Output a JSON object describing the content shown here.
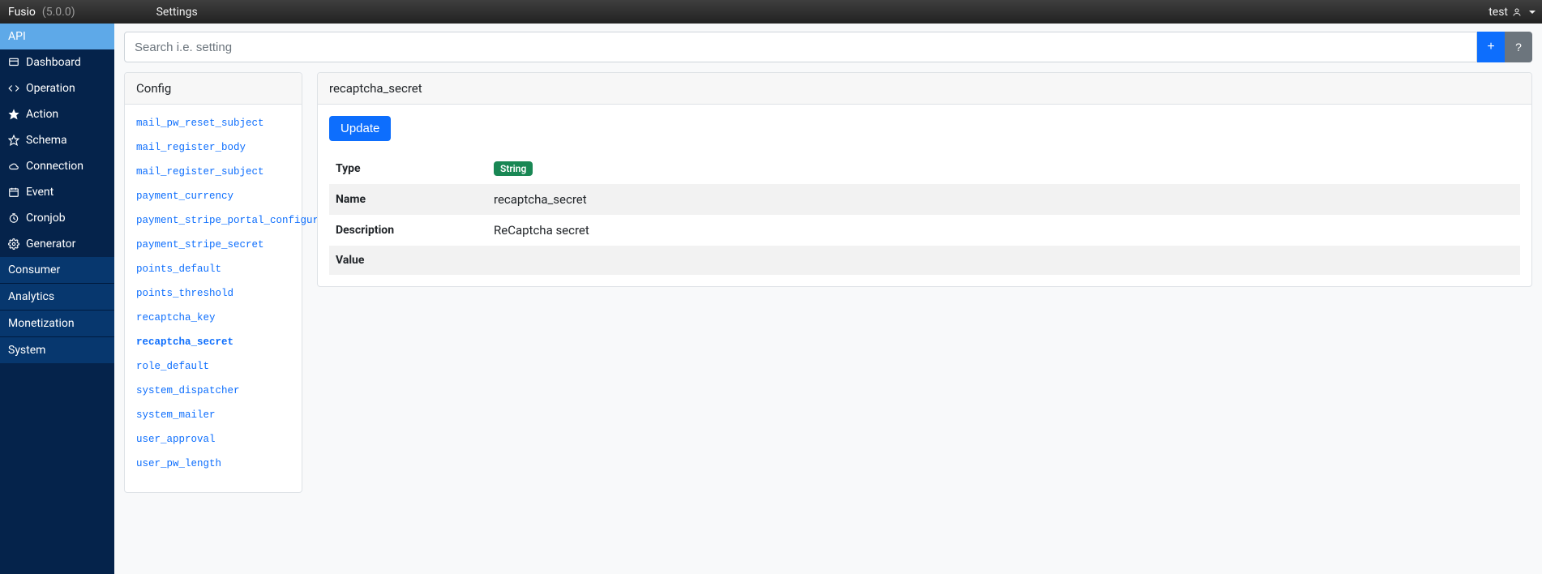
{
  "topbar": {
    "brand": "Fusio",
    "version": "(5.0.0)",
    "title": "Settings",
    "user": "test"
  },
  "sidebar": {
    "section_header": "API",
    "items": [
      {
        "id": "dashboard",
        "label": "Dashboard",
        "icon": "dashboard-icon"
      },
      {
        "id": "operation",
        "label": "Operation",
        "icon": "code-icon"
      },
      {
        "id": "action",
        "label": "Action",
        "icon": "star-icon"
      },
      {
        "id": "schema",
        "label": "Schema",
        "icon": "star-outline-icon"
      },
      {
        "id": "connection",
        "label": "Connection",
        "icon": "cloud-icon"
      },
      {
        "id": "event",
        "label": "Event",
        "icon": "calendar-icon"
      },
      {
        "id": "cronjob",
        "label": "Cronjob",
        "icon": "clock-icon"
      },
      {
        "id": "generator",
        "label": "Generator",
        "icon": "gear-icon"
      }
    ],
    "collapsed": [
      {
        "id": "consumer",
        "label": "Consumer"
      },
      {
        "id": "analytics",
        "label": "Analytics"
      },
      {
        "id": "monetization",
        "label": "Monetization"
      },
      {
        "id": "system",
        "label": "System"
      }
    ]
  },
  "search": {
    "placeholder": "Search i.e. setting",
    "add_label": "+",
    "help_label": "?"
  },
  "config_panel": {
    "header": "Config",
    "items": [
      "mail_pw_reset_subject",
      "mail_register_body",
      "mail_register_subject",
      "payment_currency",
      "payment_stripe_portal_configur",
      "payment_stripe_secret",
      "points_default",
      "points_threshold",
      "recaptcha_key",
      "recaptcha_secret",
      "role_default",
      "system_dispatcher",
      "system_mailer",
      "user_approval",
      "user_pw_length"
    ],
    "active": "recaptcha_secret"
  },
  "detail_panel": {
    "header": "recaptcha_secret",
    "update_label": "Update",
    "rows": {
      "type_label": "Type",
      "type_badge": "String",
      "name_label": "Name",
      "name_value": "recaptcha_secret",
      "description_label": "Description",
      "description_value": "ReCaptcha secret",
      "value_label": "Value",
      "value_value": ""
    }
  }
}
